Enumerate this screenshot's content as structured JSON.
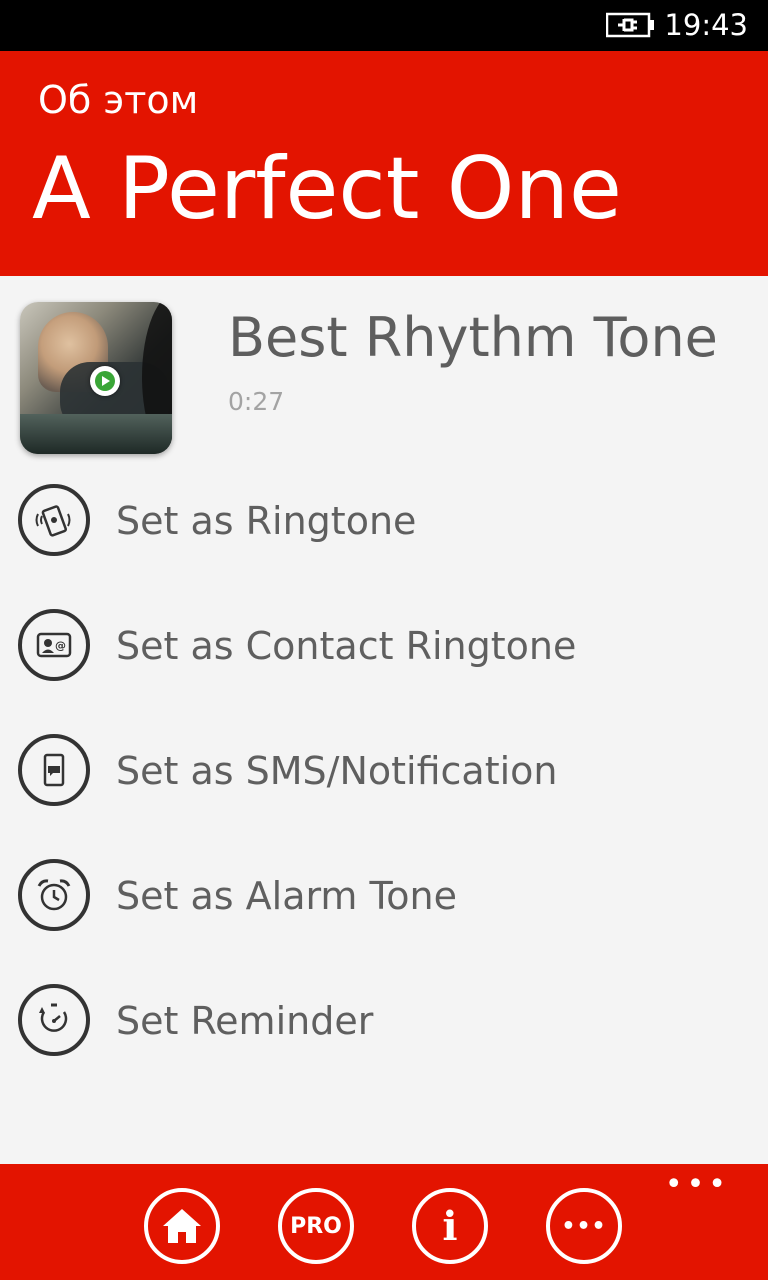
{
  "status_bar": {
    "time": "19:43",
    "battery_icon": "battery-charging-icon"
  },
  "header": {
    "subtitle": "Об этом",
    "title": "A Perfect One"
  },
  "track": {
    "name": "Best Rhythm Tone",
    "duration": "0:27",
    "play_icon": "play-icon",
    "accent": "#3aa637"
  },
  "actions": [
    {
      "icon": "phone-ringtone-icon",
      "label": "Set as Ringtone"
    },
    {
      "icon": "contact-card-icon",
      "label": "Set as Contact Ringtone"
    },
    {
      "icon": "sms-phone-icon",
      "label": "Set as SMS/Notification"
    },
    {
      "icon": "alarm-clock-icon",
      "label": "Set as Alarm Tone"
    },
    {
      "icon": "reminder-timer-icon",
      "label": "Set Reminder"
    }
  ],
  "app_bar": {
    "more_label": "•••",
    "buttons": [
      {
        "icon": "home-icon",
        "text": ""
      },
      {
        "icon": "pro-icon",
        "text": "PRO"
      },
      {
        "icon": "info-icon",
        "text": "i"
      },
      {
        "icon": "more-icon",
        "text": "•••"
      }
    ]
  },
  "colors": {
    "brand_red": "#e31400",
    "background": "#f4f4f4",
    "text": "#5f5f5f"
  }
}
